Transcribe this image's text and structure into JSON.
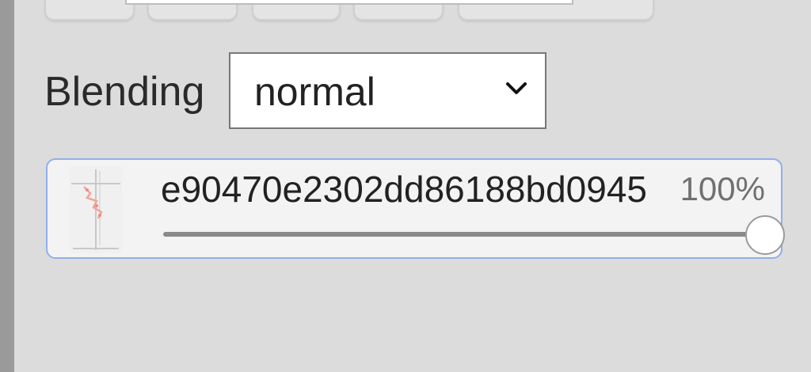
{
  "blending": {
    "label": "Blending",
    "selected": "normal"
  },
  "layer": {
    "name": "e90470e2302dd86188bd0945",
    "opacity_text": "100%",
    "opacity_fraction": 1.0
  },
  "colors": {
    "panel_bg": "#dcdcdc",
    "layer_border": "#8fb0ea",
    "select_border": "#777777"
  },
  "icons": {
    "thumbnail": "layer-thumbnail",
    "dropdown": "chevron-down-icon"
  }
}
